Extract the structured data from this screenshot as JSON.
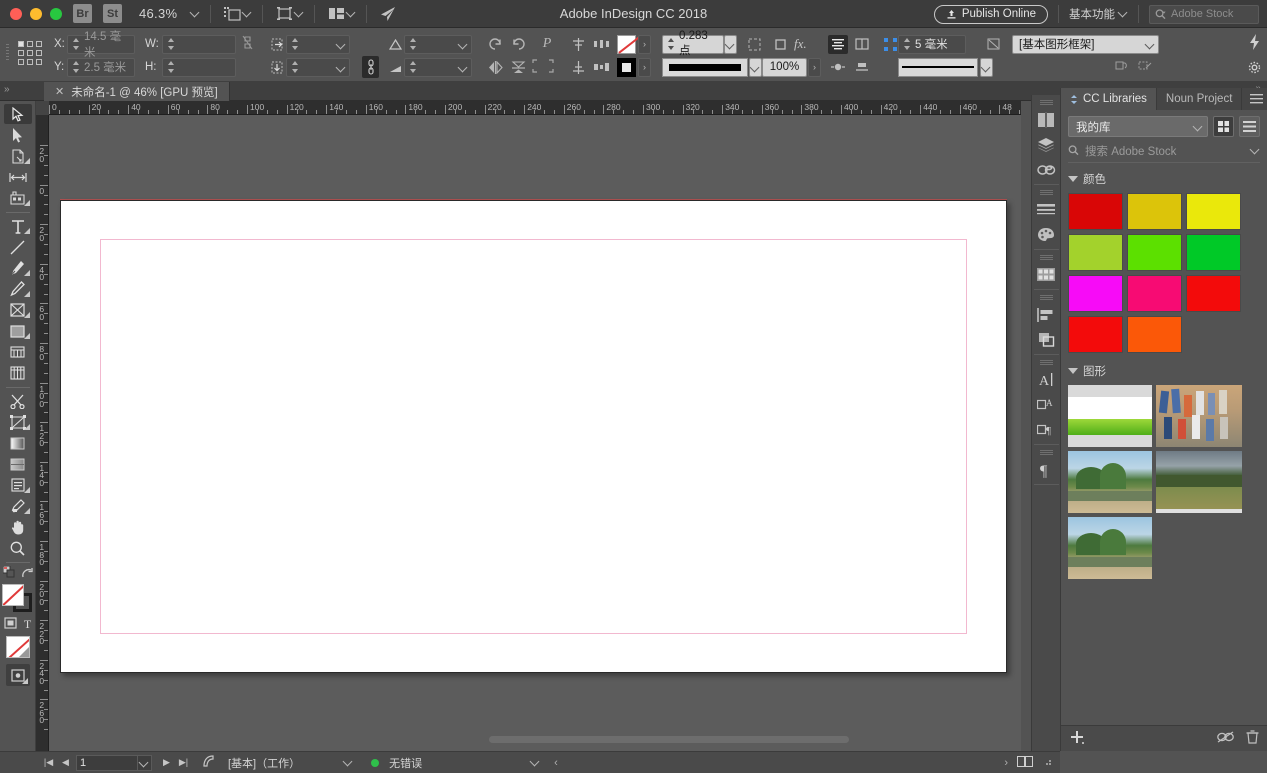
{
  "titlebar": {
    "app_title": "Adobe InDesign CC 2018",
    "bridge_label": "Br",
    "stock_label": "St",
    "zoom_level": "46.3%",
    "publish_label": "Publish Online",
    "workspace": "基本功能",
    "stock_placeholder": "Adobe Stock"
  },
  "control_bar": {
    "x_label": "X:",
    "x_value": "14.5 毫米",
    "y_label": "Y:",
    "y_value": "2.5 毫米",
    "w_label": "W:",
    "w_value": "",
    "h_label": "H:",
    "h_value": "",
    "rotate_value": "",
    "shear_value": "",
    "scale_x_value": "",
    "scale_y_value": "",
    "stroke_weight": "0.283 点",
    "opacity": "100%",
    "corner_radius": "5 毫米",
    "object_style": "[基本图形框架]",
    "p_label": "P"
  },
  "tab": {
    "close_glyph": "✕",
    "doc_title": "未命名-1 @ 46% [GPU 预览]"
  },
  "toolbar": {
    "tools": [
      {
        "name": "selection-tool",
        "active": true
      },
      {
        "name": "direct-selection-tool",
        "active": false
      },
      {
        "name": "page-tool",
        "active": false
      },
      {
        "name": "gap-tool",
        "active": false
      },
      {
        "name": "content-collector-tool",
        "active": false
      },
      {
        "name": "type-tool",
        "active": false
      },
      {
        "name": "line-tool",
        "active": false
      },
      {
        "name": "pen-tool",
        "active": false
      },
      {
        "name": "pencil-tool",
        "active": false
      },
      {
        "name": "frame-tool",
        "active": false
      },
      {
        "name": "rectangle-tool",
        "active": false
      },
      {
        "name": "free-transform-tool",
        "active": false
      },
      {
        "name": "table-tool",
        "active": false
      },
      {
        "name": "scissors-tool",
        "active": false
      },
      {
        "name": "transform-tool",
        "active": false
      },
      {
        "name": "gradient-swatch-tool",
        "active": false
      },
      {
        "name": "gradient-feather-tool",
        "active": false
      },
      {
        "name": "note-tool",
        "active": false
      },
      {
        "name": "eyedropper-tool",
        "active": false
      },
      {
        "name": "hand-tool",
        "active": false
      },
      {
        "name": "zoom-tool",
        "active": false
      }
    ]
  },
  "rulers": {
    "h_labels": [
      "0",
      "20",
      "40",
      "60",
      "80",
      "100",
      "120",
      "140",
      "160",
      "180",
      "200",
      "220",
      "240",
      "260",
      "280",
      "300",
      "320",
      "340",
      "360",
      "380",
      "400",
      "420",
      "440",
      "460",
      "48"
    ],
    "v_labels": [
      "2 0",
      "0",
      "2 0",
      "4 0",
      "6 0",
      "8 0",
      "1 0 0",
      "1 2 0",
      "1 4 0",
      "1 6 0",
      "1 8 0",
      "2 0 0",
      "2 2 0",
      "2 4 0",
      "2 6 0"
    ]
  },
  "statusbar": {
    "page_number": "1",
    "master_page": "[基本]（工作）",
    "error_status": "无错误"
  },
  "cc_libraries": {
    "tab_primary": "CC Libraries",
    "tab_secondary": "Noun Project",
    "library_select": "我的库",
    "search_placeholder": "搜索 Adobe Stock",
    "sections": [
      {
        "title": "颜色",
        "type": "colors",
        "swatches": [
          "#d90606",
          "#dcc40a",
          "#eae80b",
          "#a3d22c",
          "#5ce000",
          "#00c927",
          "#f70bf7",
          "#f70b73",
          "#f30b0b",
          "#f30b0b",
          "#fb5808"
        ]
      },
      {
        "title": "图形",
        "type": "graphics",
        "items": [
          {
            "name": "grass-field-thumbnail"
          },
          {
            "name": "crowd-stairs-thumbnail"
          },
          {
            "name": "river-mountains-thumbnail"
          },
          {
            "name": "meadow-hills-thumbnail"
          },
          {
            "name": "river-mountains-thumbnail-2"
          }
        ]
      }
    ]
  }
}
